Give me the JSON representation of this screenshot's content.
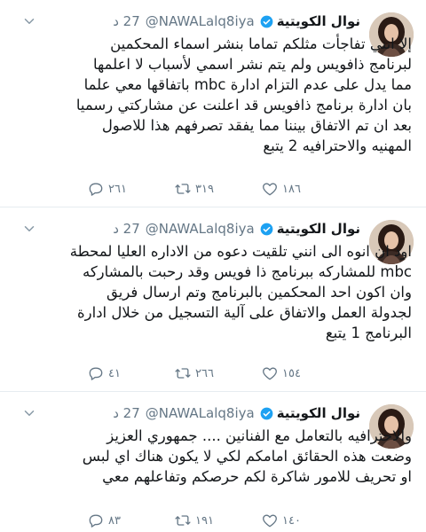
{
  "tweets": [
    {
      "display_name": "نوال الكويتية",
      "handle": "@NAWALalq8iya",
      "time": "27 د",
      "lines": [
        "إلا انني تفاجأت مثلكم تماما بنشر اسماء المحكمين",
        "لبرنامج ذافويس ولم يتم نشر اسمي لأسباب لا اعلمها",
        "مما يدل على عدم التزام ادارة mbc باتفاقها معي علما",
        "بان ادارة برنامج ذافويس قد اعلنت عن مشاركتي رسميا",
        "بعد ان تم الاتفاق بيننا مما يفقد تصرفهم هذا للاصول",
        "المهنيه والاحترافيه 2 يتبع"
      ],
      "replies": "٢٦١",
      "retweets": "٣١٩",
      "likes": "١٨٦"
    },
    {
      "display_name": "نوال الكويتية",
      "handle": "@NAWALalq8iya",
      "time": "27 د",
      "lines": [
        "اود ان انوه الى انني تلقيت دعوه من الاداره العليا لمحطة",
        "mbc للمشاركه ببرنامج ذا فويس وقد رحبت بالمشاركه",
        "وان اكون احد المحكمين بالبرنامج وتم ارسال فريق",
        "لجدولة العمل والاتفاق على آلية التسجيل من خلال ادارة",
        "البرنامج 1 يتبع"
      ],
      "replies": "٤١",
      "retweets": "٢٦٦",
      "likes": "١٥٤"
    },
    {
      "display_name": "نوال الكويتية",
      "handle": "@NAWALalq8iya",
      "time": "27 د",
      "lines": [
        "والاحترافيه بالتعامل مع الفنانين .... جمهوري العزيز",
        "وضعت هذه الحقائق امامكم لكي لا يكون هناك اي لبس",
        "او تحريف للامور شاكرة لكم حرصكم وتفاعلهم معي"
      ],
      "replies": "٨٣",
      "retweets": "١٩١",
      "likes": "١٤٠"
    }
  ],
  "colors": {
    "text": "#14171a",
    "secondary": "#657786",
    "verified": "#1da1f2",
    "divider": "#e6ecf0"
  },
  "icons": {
    "reply": "reply-icon",
    "retweet": "retweet-icon",
    "like": "heart-icon",
    "more": "chevron-down-icon",
    "verified": "verified-badge-icon"
  }
}
